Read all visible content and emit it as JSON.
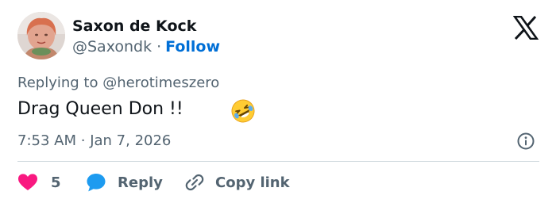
{
  "author": {
    "name": "Saxon de Kock",
    "handle": "@Saxondk",
    "separator": "·",
    "follow_label": "Follow"
  },
  "tweet": {
    "replying_prefix": "Replying to ",
    "replying_to": "@herotimeszero",
    "text": "Drag Queen Don !!",
    "emoji": "rolling-on-the-floor-laughing",
    "time": "7:53 AM",
    "date_separator": "·",
    "date": "Jan 7, 2026"
  },
  "actions": {
    "like_count": "5",
    "reply_label": "Reply",
    "copy_link_label": "Copy link"
  },
  "icons": {
    "brand": "x-logo-icon",
    "info": "info-icon",
    "like": "heart-icon",
    "reply": "speech-bubble-icon",
    "copy": "link-icon"
  },
  "colors": {
    "text_primary": "#0f1419",
    "text_secondary": "#536471",
    "link": "#006fd6",
    "heart": "#f91880",
    "reply_bubble": "#1d9bf0",
    "divider": "#cfd9de"
  }
}
